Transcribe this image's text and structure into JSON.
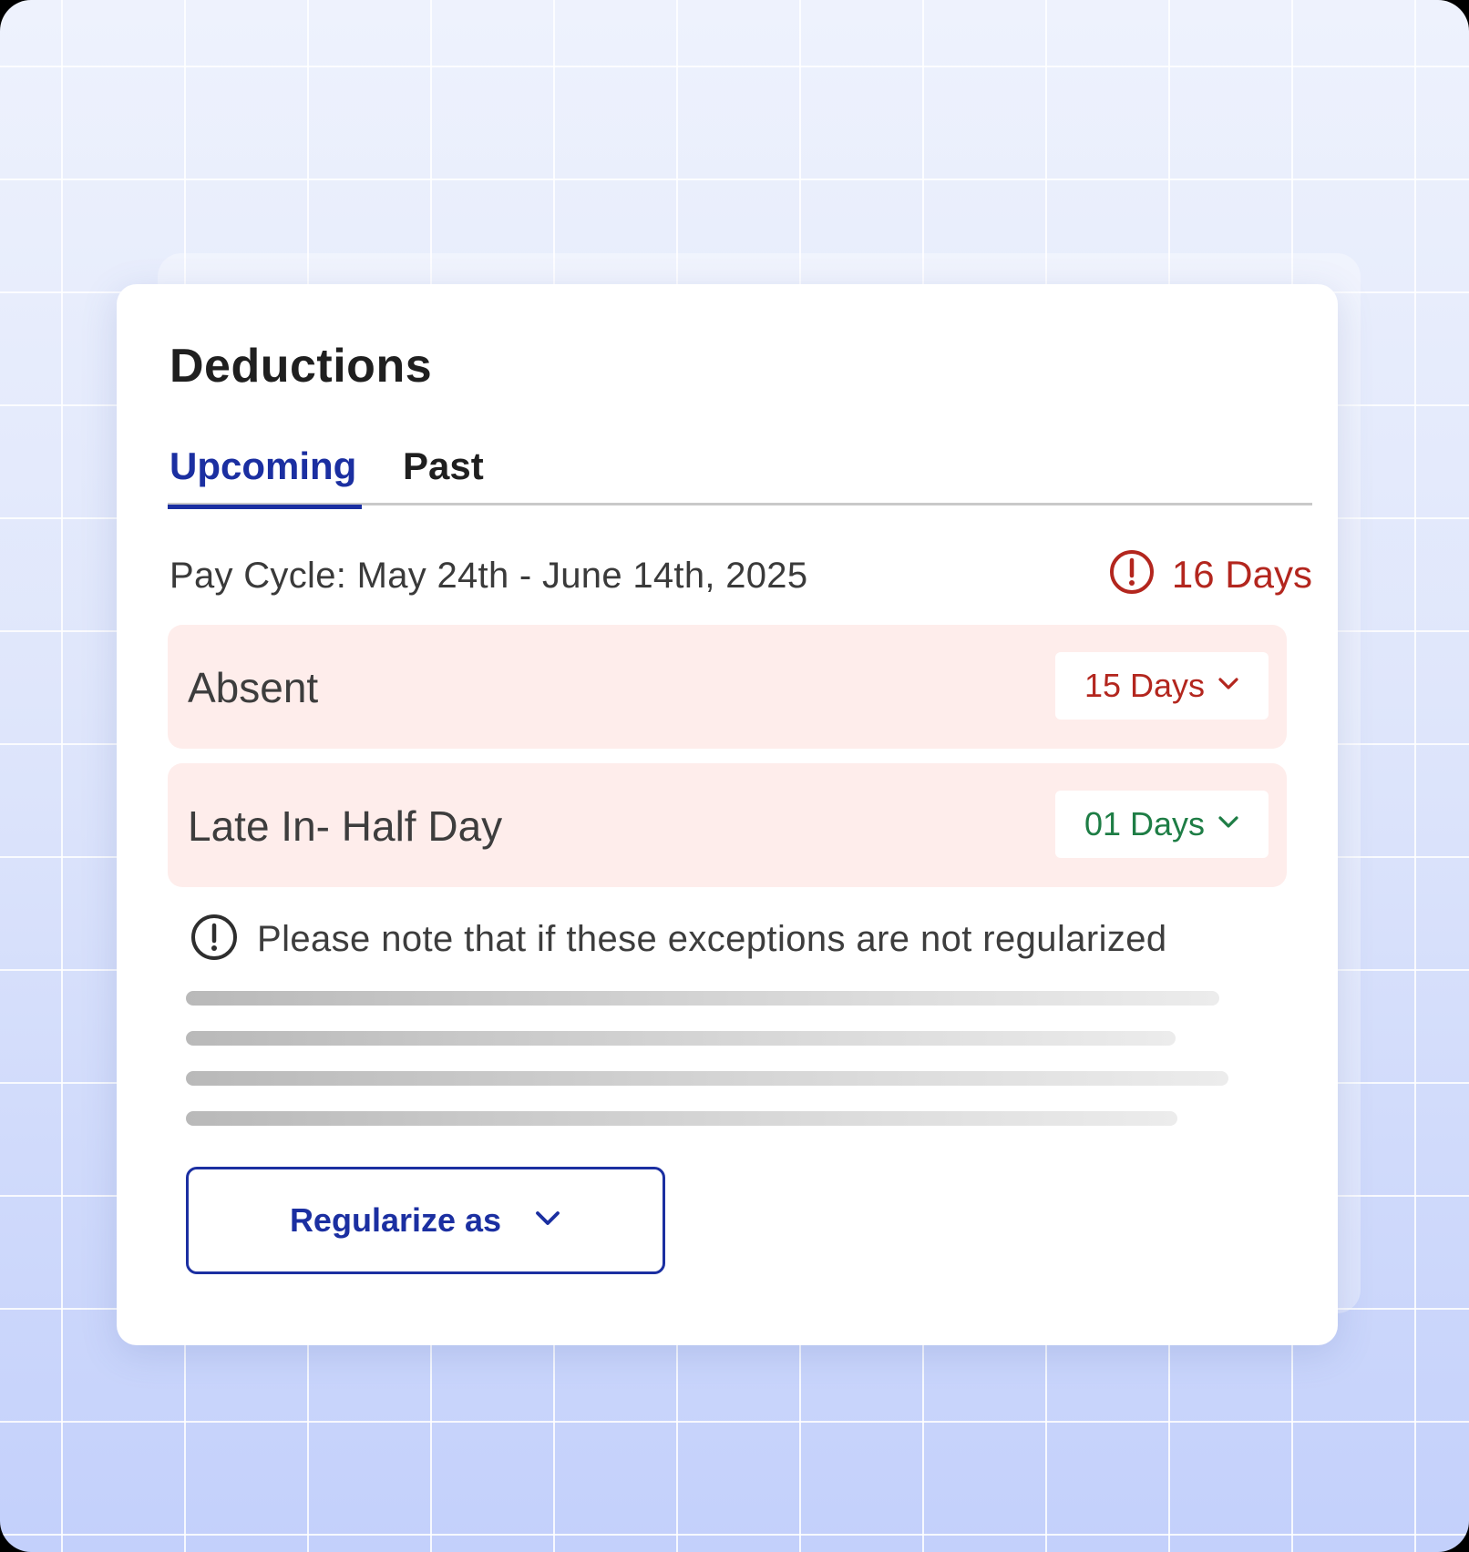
{
  "card": {
    "title": "Deductions"
  },
  "tabs": [
    {
      "label": "Upcoming",
      "active": true
    },
    {
      "label": "Past",
      "active": false
    }
  ],
  "pay_cycle": {
    "text": "Pay Cycle: May 24th - June 14th, 2025",
    "total_days": "16 Days",
    "icon": "alert-circle-icon"
  },
  "exceptions": [
    {
      "label": "Absent",
      "days": "15 Days",
      "days_color": "#b3261e"
    },
    {
      "label": "Late In- Half Day",
      "days": "01 Days",
      "days_color": "#1e7d45"
    }
  ],
  "note": {
    "text": "Please note that if these exceptions are not regularized",
    "icon": "alert-circle-icon"
  },
  "action": {
    "label": "Regularize as",
    "icon": "chevron-down-icon"
  },
  "colors": {
    "accent": "#1b2fa1",
    "danger": "#b3261e",
    "success": "#1e7d45",
    "exception_bg": "#feedeb"
  }
}
